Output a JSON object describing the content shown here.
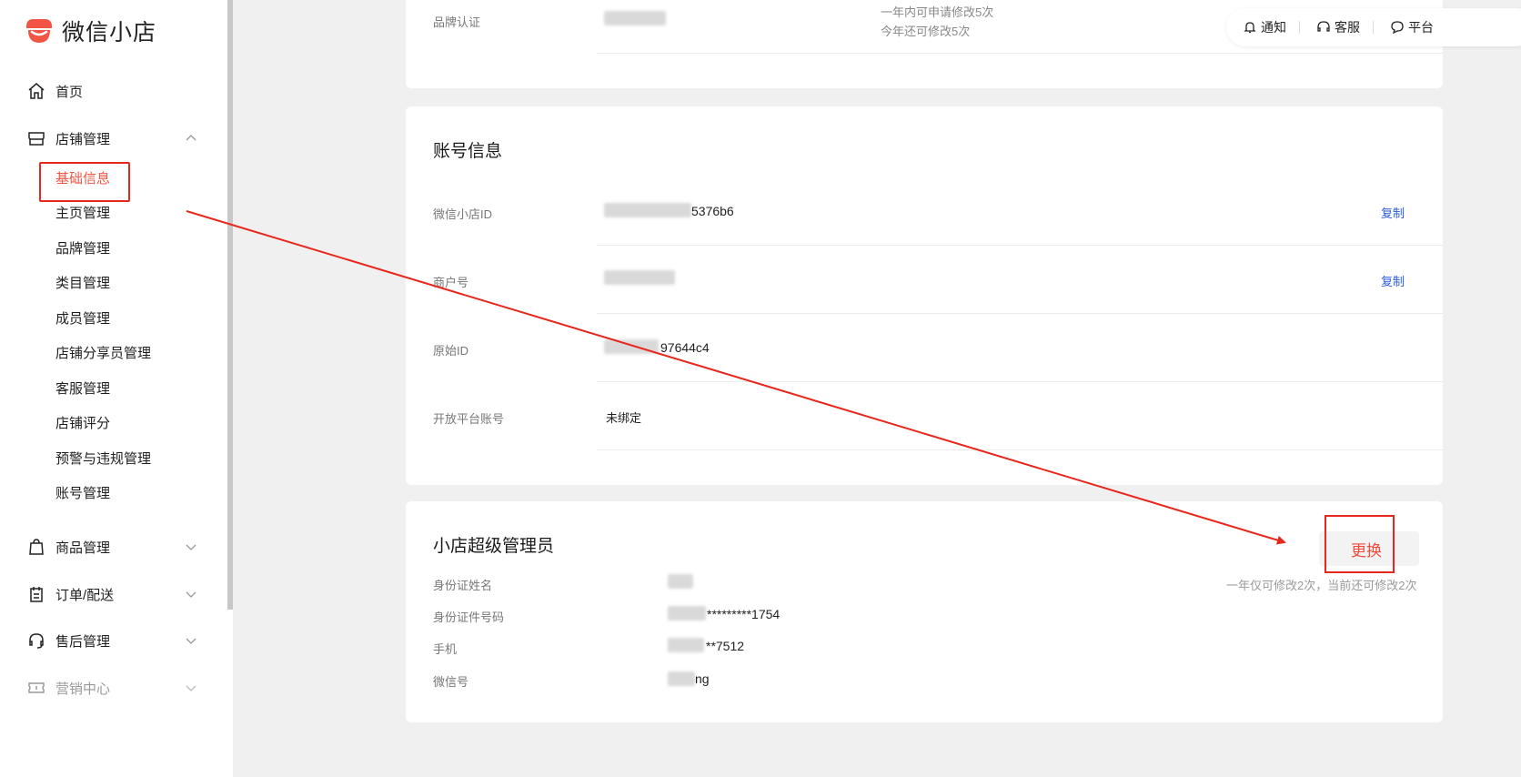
{
  "brand": {
    "name": "微信小店"
  },
  "sidebar": {
    "home": "首页",
    "store_mgmt": "店铺管理",
    "store_sub": [
      "基础信息",
      "主页管理",
      "品牌管理",
      "类目管理",
      "成员管理",
      "店铺分享员管理",
      "客服管理",
      "店铺评分",
      "预警与违规管理",
      "账号管理"
    ],
    "goods": "商品管理",
    "orders": "订单/配送",
    "after_sales": "售后管理",
    "marketing": "营销中心"
  },
  "topbar": {
    "notify": "通知",
    "service": "客服",
    "platform": "平台"
  },
  "brand_card": {
    "label": "品牌认证",
    "note1": "一年内可申请修改5次",
    "note2": "今年还可修改5次"
  },
  "account": {
    "title": "账号信息",
    "copy_label": "复制",
    "rows": [
      {
        "label": "微信小店ID",
        "value": "5376b6"
      },
      {
        "label": "商户号",
        "value": ""
      },
      {
        "label": "原始ID",
        "value": "97644c4"
      },
      {
        "label": "开放平台账号",
        "value": "未绑定"
      }
    ]
  },
  "admin": {
    "title": "小店超级管理员",
    "replace_label": "更换",
    "quota_note": "一年仅可修改2次，当前还可修改2次",
    "rows": [
      {
        "label": "身份证姓名",
        "value": ""
      },
      {
        "label": "身份证件号码",
        "value": "*********1754"
      },
      {
        "label": "手机",
        "value": "**7512"
      },
      {
        "label": "微信号",
        "value": "ng"
      }
    ]
  },
  "colors": {
    "accent": "#f25544",
    "annotation": "#e8271c",
    "link": "#2a5bd7"
  }
}
